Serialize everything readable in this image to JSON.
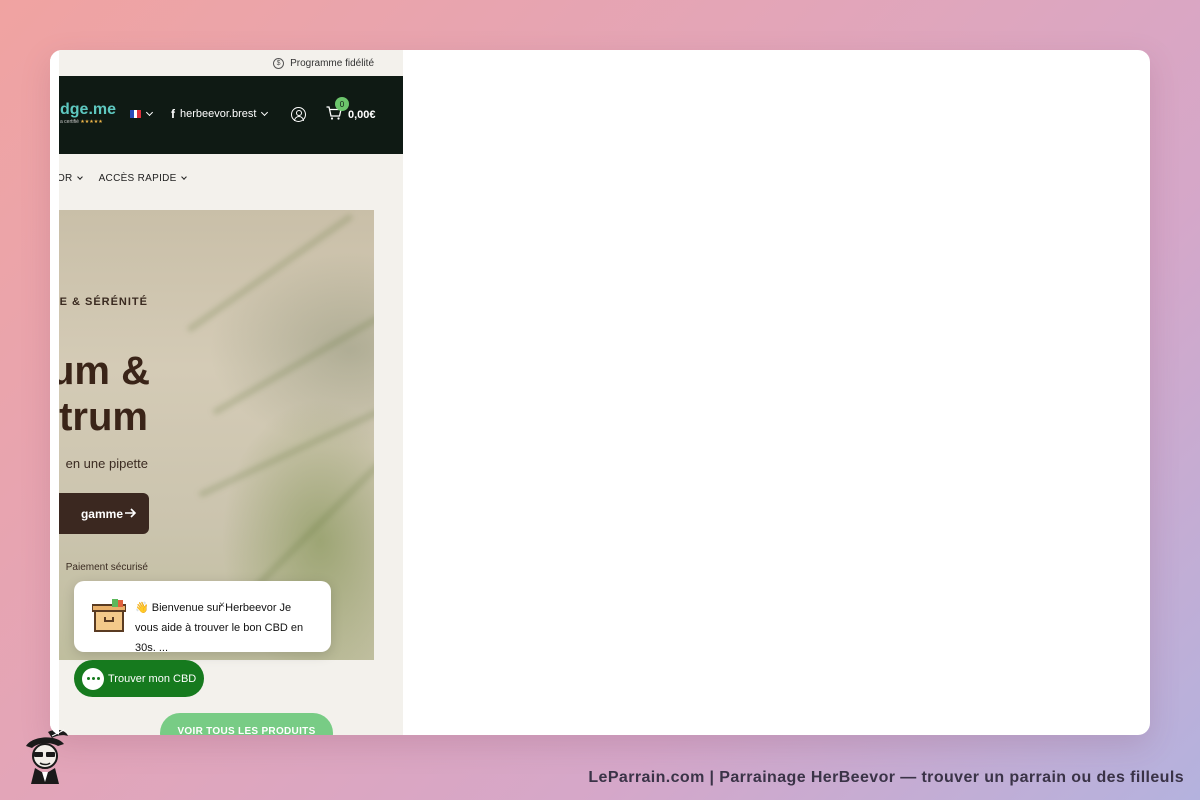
{
  "colors": {
    "header_bg": "#0f1a14",
    "cta_bg": "#3b2820",
    "chat_green": "#167a1e",
    "product_button": "#78cc85",
    "badge_green": "#6cc56c"
  },
  "topbar": {
    "loyalty_icon": "dollar-coin-icon",
    "loyalty_label": "Programme fidélité"
  },
  "header": {
    "logo_text": "dge.me",
    "logo_sub": "a certifié",
    "logo_stars": "★★★★★",
    "language": "FR",
    "facebook_glyph": "f",
    "facebook_label": "herbeevor.brest",
    "cart_count": "0",
    "cart_total": "0,00€"
  },
  "nav": {
    "items": [
      {
        "label": "VOR"
      },
      {
        "label": "ACCÈS RAPIDE"
      }
    ]
  },
  "hero": {
    "kicker": "CE & SÉRÉNITÉ",
    "title_line1": "um &",
    "title_line2": "trum",
    "subtitle": "en une pipette",
    "cta_label": "gamme",
    "secure_label": "Paiement sécurisé"
  },
  "chat": {
    "message": "👋 Bienvenue sur Herbeevor Je vous aide à trouver le bon CBD en 30s. ...",
    "close_glyph": "×",
    "button_label": "Trouver mon CBD"
  },
  "products_button": "VOIR TOUS LES PRODUITS",
  "caption": "LeParrain.com | Parrainage HerBeevor — trouver un parrain ou des filleuls"
}
